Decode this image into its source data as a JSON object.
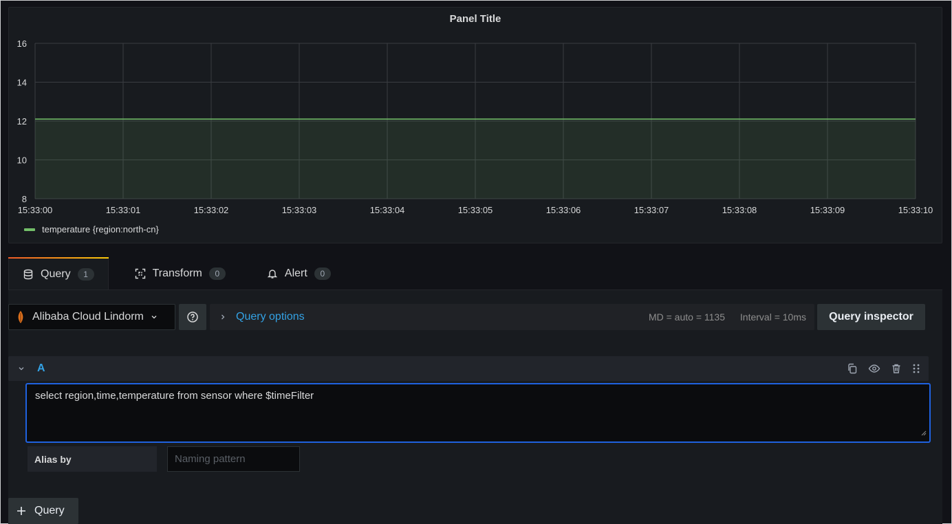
{
  "panel": {
    "title": "Panel Title",
    "legend": {
      "label": "temperature {region:north-cn}",
      "color": "#73bf69"
    }
  },
  "chart_data": {
    "type": "area",
    "x": [
      "15:33:00",
      "15:33:01",
      "15:33:02",
      "15:33:03",
      "15:33:04",
      "15:33:05",
      "15:33:06",
      "15:33:07",
      "15:33:08",
      "15:33:09",
      "15:33:10"
    ],
    "series": [
      {
        "name": "temperature {region:north-cn}",
        "values": [
          12.1,
          12.1,
          12.1,
          12.1,
          12.1,
          12.1,
          12.1,
          12.1,
          12.1,
          12.1,
          12.1
        ]
      }
    ],
    "y_ticks": [
      "8",
      "10",
      "12",
      "14",
      "16"
    ],
    "ylim": [
      8,
      16
    ],
    "grid": true,
    "legend_position": "bottom-left",
    "line_color": "#73bf69"
  },
  "tabs": [
    {
      "label": "Query",
      "count": "1",
      "icon": "database-icon"
    },
    {
      "label": "Transform",
      "count": "0",
      "icon": "transform-icon"
    },
    {
      "label": "Alert",
      "count": "0",
      "icon": "bell-icon"
    }
  ],
  "toolbar": {
    "datasource": "Alibaba Cloud Lindorm",
    "query_options_label": "Query options",
    "md": "MD = auto = 1135",
    "interval": "Interval = 10ms",
    "inspector_label": "Query inspector"
  },
  "query": {
    "ref_id": "A",
    "text": "select region,time,temperature from sensor where $timeFilter",
    "alias_label": "Alias by",
    "alias_placeholder": "Naming pattern"
  },
  "add_query_label": "Query",
  "colors": {
    "accent_blue": "#33a2e5",
    "focus_border": "#1f62e0"
  }
}
